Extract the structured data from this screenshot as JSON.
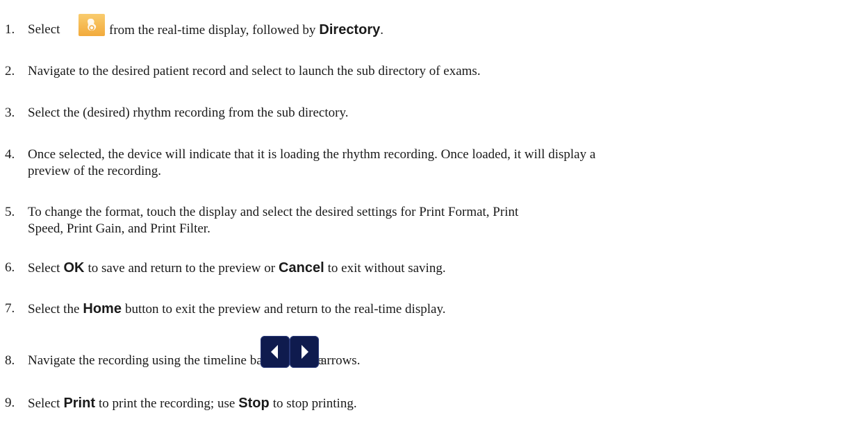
{
  "steps": [
    {
      "number": "1.",
      "text_a": "Select",
      "icon": "menu-icon",
      "text_b": "from the real-time display, followed by",
      "bold": "Directory",
      "text_c": "."
    },
    {
      "number": "2.",
      "text": "Navigate to the desired patient record and select to launch the sub directory of exams."
    },
    {
      "number": "3.",
      "text": "Select the (desired) rhythm recording from the sub directory."
    },
    {
      "number": "4.",
      "line1": "Once selected, the device will indicate that it is loading the rhythm recording. Once loaded, it will display a",
      "line2": "preview of the recording."
    },
    {
      "number": "5.",
      "line1": "To change the format, touch the display and select the desired settings for Print Format, Print",
      "line2": "Speed, Print Gain, and Print Filter."
    },
    {
      "number": "6.",
      "text_a": "Select",
      "bold_a": "OK",
      "text_b": "to save and return to the preview or",
      "bold_b": "Cancel",
      "text_c": "to exit without saving."
    },
    {
      "number": "7.",
      "text_a": "Select the",
      "bold": "Home",
      "text_b": "button to exit the preview and return to the real-time display."
    },
    {
      "number": "8.",
      "text_a": "Navigate the recording using the timeline bar and/or the",
      "icons": [
        "left-arrow-icon",
        "right-arrow-icon"
      ],
      "text_b": "arrows."
    },
    {
      "number": "9.",
      "text_a": "Select",
      "bold_a": "Print",
      "text_b": "to print the recording; use",
      "bold_b": "Stop",
      "text_c": "to stop printing."
    }
  ],
  "colors": {
    "menu_icon": "#f2aa3c",
    "arrow_button": "#0f1b4e",
    "text": "#1a1a1a"
  }
}
